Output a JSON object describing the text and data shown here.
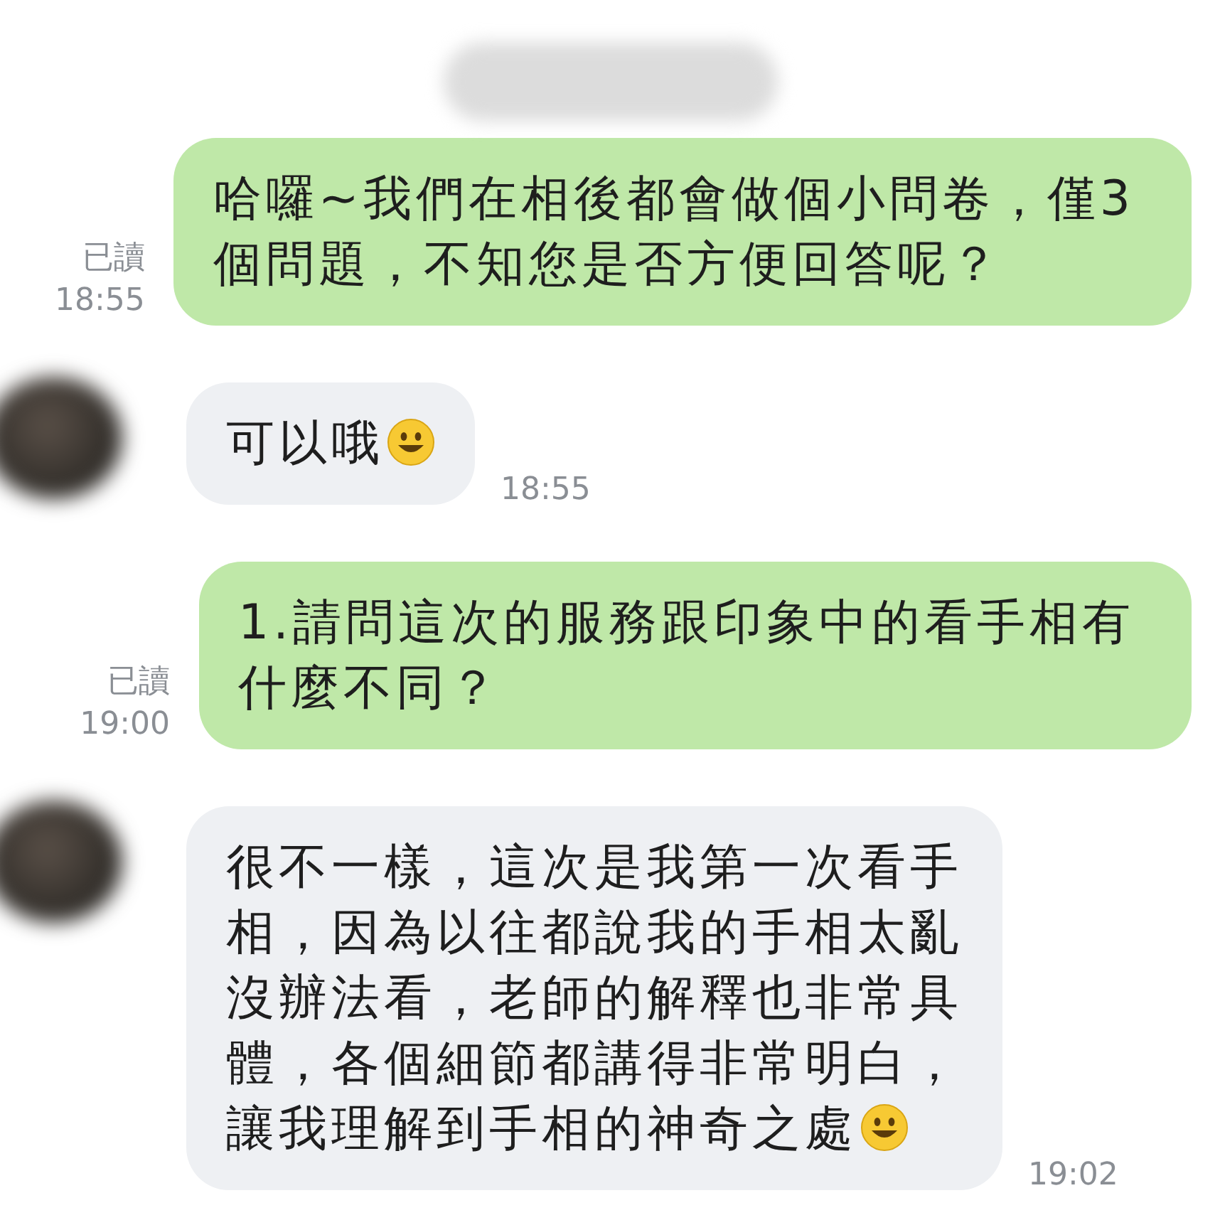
{
  "messages": [
    {
      "kind": "outgoing",
      "lines": [
        "哈囉~我們在相後都會做個小問卷，僅3",
        "個問題，不知您是否方便回答呢？"
      ],
      "read": "已讀",
      "time": "18:55",
      "trailing_emoji": false
    },
    {
      "kind": "incoming",
      "lines": [
        "可以哦"
      ],
      "time": "18:55",
      "trailing_emoji": true
    },
    {
      "kind": "outgoing",
      "lines": [
        "1.請問這次的服務跟印象中的看手相有",
        "什麼不同？"
      ],
      "read": "已讀",
      "time": "19:00",
      "trailing_emoji": false
    },
    {
      "kind": "incoming",
      "lines": [
        "很不一樣，這次是我第一次看手",
        "相，因為以往都說我的手相太亂",
        "沒辦法看，老師的解釋也非常具",
        "體，各個細節都講得非常明白，",
        "讓我理解到手相的神奇之處"
      ],
      "time": "19:02",
      "trailing_emoji": true
    }
  ]
}
